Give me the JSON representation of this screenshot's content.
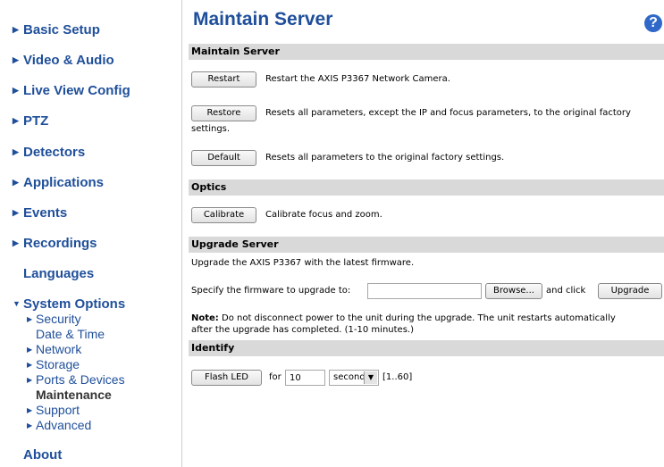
{
  "sidebar": {
    "items": [
      {
        "label": "Basic Setup"
      },
      {
        "label": "Video & Audio"
      },
      {
        "label": "Live View Config"
      },
      {
        "label": "PTZ"
      },
      {
        "label": "Detectors"
      },
      {
        "label": "Applications"
      },
      {
        "label": "Events"
      },
      {
        "label": "Recordings"
      },
      {
        "label": "Languages"
      },
      {
        "label": "System Options"
      },
      {
        "label": "About"
      }
    ],
    "system_options_sub": [
      {
        "label": "Security"
      },
      {
        "label": "Date & Time"
      },
      {
        "label": "Network"
      },
      {
        "label": "Storage"
      },
      {
        "label": "Ports & Devices"
      },
      {
        "label": "Maintenance"
      },
      {
        "label": "Support"
      },
      {
        "label": "Advanced"
      }
    ]
  },
  "main": {
    "title": "Maintain Server",
    "help_icon": "?",
    "sections": {
      "maintain": "Maintain Server",
      "optics": "Optics",
      "upgrade": "Upgrade Server",
      "identify": "Identify"
    },
    "maintain": {
      "restart_label": "Restart",
      "restart_desc": "Restart the AXIS P3367 Network Camera.",
      "restore_label": "Restore",
      "restore_desc_1": "Resets all parameters, except the IP and focus parameters, to the original factory",
      "restore_desc_2": "settings.",
      "default_label": "Default",
      "default_desc": "Resets all parameters to the original factory settings."
    },
    "optics": {
      "calibrate_label": "Calibrate",
      "calibrate_desc": "Calibrate focus and zoom."
    },
    "upgrade": {
      "intro": "Upgrade the AXIS P3367 with the latest firmware.",
      "specify": "Specify the firmware to upgrade to:",
      "file_value": "",
      "browse_label": "Browse...",
      "and_click": "and click",
      "upgrade_label": "Upgrade",
      "note_bold": "Note:",
      "note_1": "Do not disconnect power to the unit during the upgrade. The unit restarts automatically",
      "note_2": "after the upgrade has completed. (1-10 minutes.)"
    },
    "identify": {
      "flash_label": "Flash LED",
      "for_label": "for",
      "duration_value": "10",
      "unit_value": "seconds",
      "range": "[1..60]"
    }
  }
}
